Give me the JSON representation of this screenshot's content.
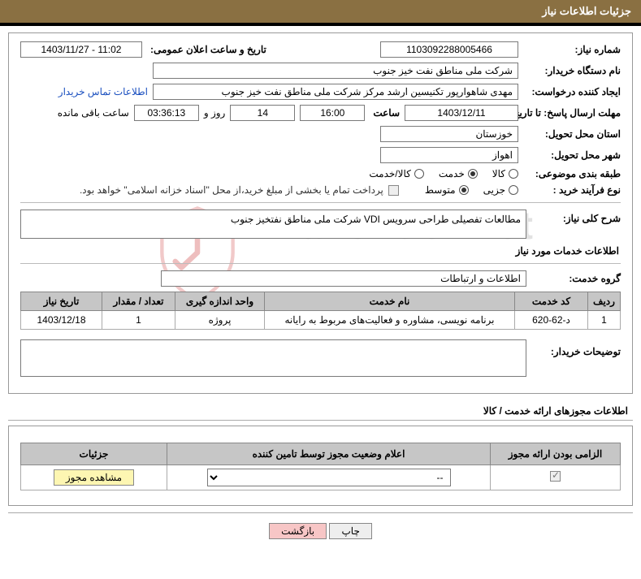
{
  "header": {
    "title": "جزئیات اطلاعات نیاز"
  },
  "fields": {
    "need_no_label": "شماره نیاز:",
    "need_no": "1103092288005466",
    "announce_label": "تاریخ و ساعت اعلان عمومی:",
    "announce_val": "1403/11/27 - 11:02",
    "buyer_org_label": "نام دستگاه خریدار:",
    "buyer_org": "شرکت ملی مناطق نفت خیز جنوب",
    "requester_label": "ایجاد کننده درخواست:",
    "requester": "مهدی شاهوارپور تکنیسین ارشد مرکز شرکت ملی مناطق نفت خیز جنوب",
    "contact_link": "اطلاعات تماس خریدار",
    "deadline_label": "مهلت ارسال پاسخ: تا تاریخ:",
    "deadline_date": "1403/12/11",
    "time_label": "ساعت",
    "deadline_time": "16:00",
    "days_val": "14",
    "days_and": "روز و",
    "countdown": "03:36:13",
    "remaining": "ساعت باقی مانده",
    "province_label": "استان محل تحویل:",
    "province": "خوزستان",
    "city_label": "شهر محل تحویل:",
    "city": "اهواز",
    "category_label": "طبقه بندی موضوعی:",
    "cat_goods": "کالا",
    "cat_service": "خدمت",
    "cat_goods_service": "کالا/خدمت",
    "process_label": "نوع فرآیند خرید :",
    "proc_partial": "جزیی",
    "proc_medium": "متوسط",
    "payment_note": "پرداخت تمام یا بخشی از مبلغ خرید،از محل \"اسناد خزانه اسلامی\" خواهد بود.",
    "summary_label": "شرح کلی نیاز:",
    "summary": "مطالعات تفصیلی طراحی سرویس VDI شرکت ملی مناطق نفتخیز جنوب",
    "services_section": "اطلاعات خدمات مورد نیاز",
    "service_group_label": "گروه خدمت:",
    "service_group": "اطلاعات و ارتباطات",
    "buyer_notes_label": "توضیحات خریدار:"
  },
  "services_table": {
    "headers": {
      "row": "ردیف",
      "code": "کد خدمت",
      "name": "نام خدمت",
      "unit": "واحد اندازه گیری",
      "qty": "تعداد / مقدار",
      "date": "تاریخ نیاز"
    },
    "rows": [
      {
        "row": "1",
        "code": "د-62-620",
        "name": "برنامه نویسی، مشاوره و فعالیت‌های مربوط به رایانه",
        "unit": "پروژه",
        "qty": "1",
        "date": "1403/12/18"
      }
    ]
  },
  "license": {
    "section_title": "اطلاعات مجوزهای ارائه خدمت / کالا",
    "headers": {
      "mandatory": "الزامی بودن ارائه مجوز",
      "status": "اعلام وضعیت مجوز توسط تامین کننده",
      "details": "جزئیات"
    },
    "select_placeholder": "--",
    "view_btn": "مشاهده مجوز"
  },
  "footer": {
    "print": "چاپ",
    "back": "بازگشت"
  }
}
